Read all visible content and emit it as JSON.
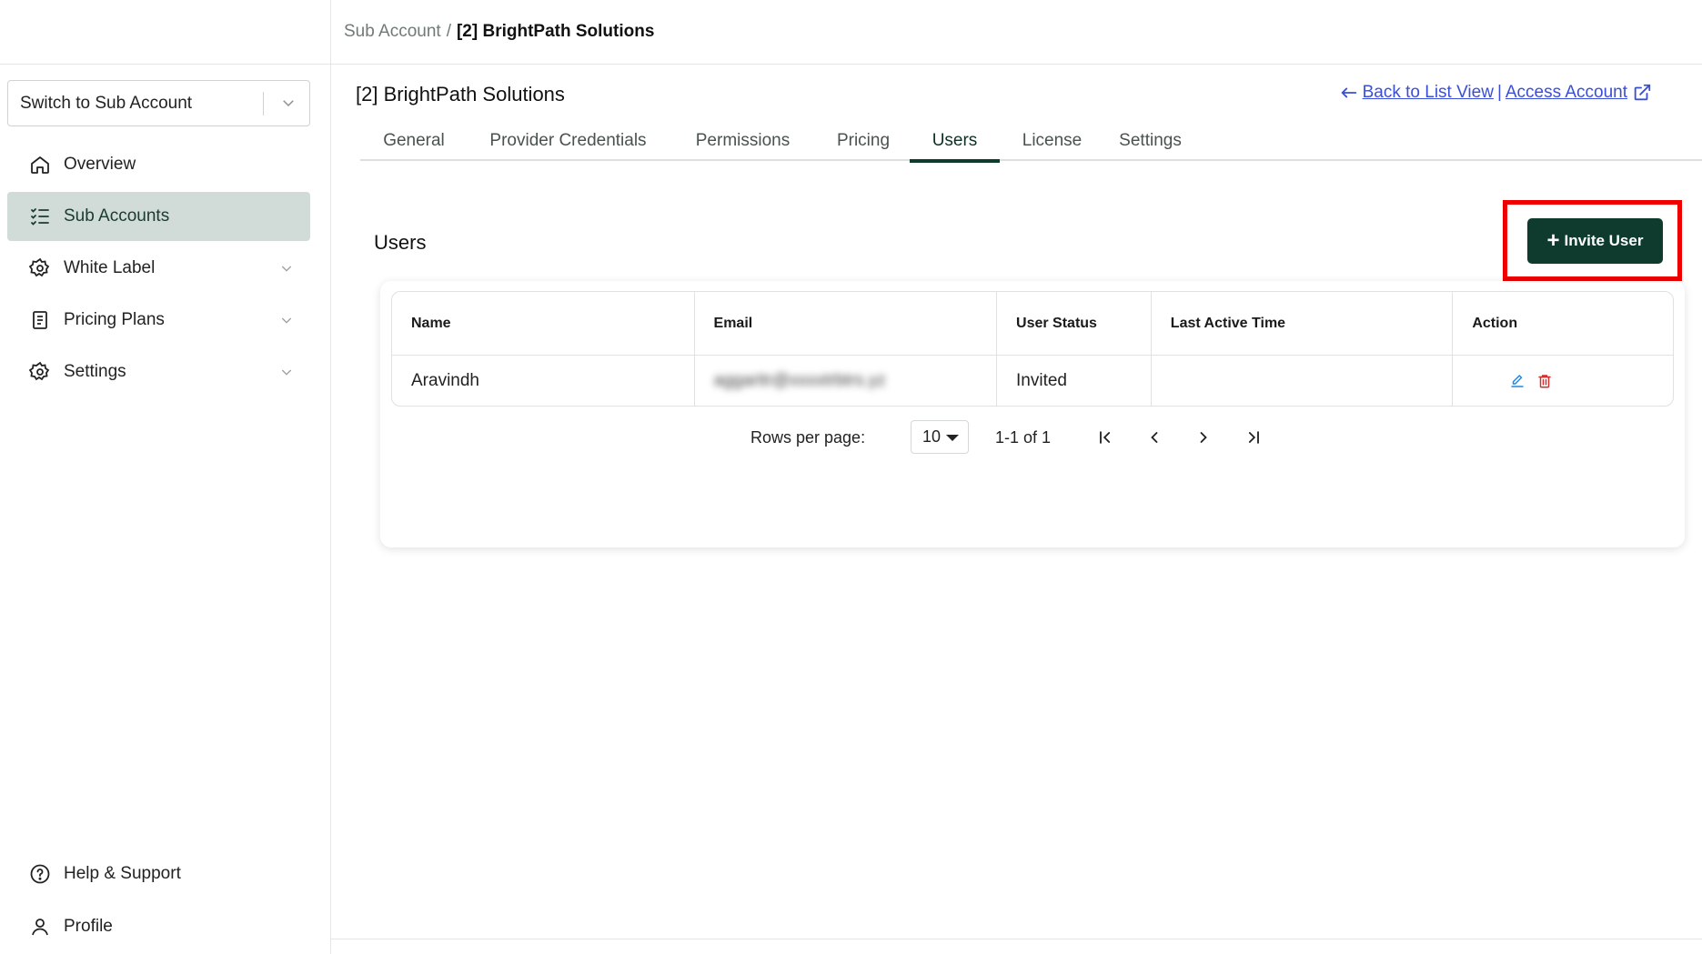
{
  "breadcrumb": {
    "parent": "Sub Account",
    "separator": "/",
    "current": "[2] BrightPath Solutions"
  },
  "sidebar": {
    "switch_placeholder": "Switch to Sub Account",
    "items": [
      {
        "label": "Overview",
        "icon": "home-icon"
      },
      {
        "label": "Sub Accounts",
        "icon": "checklist-icon"
      },
      {
        "label": "White Label",
        "icon": "gear-icon"
      },
      {
        "label": "Pricing Plans",
        "icon": "receipt-icon"
      },
      {
        "label": "Settings",
        "icon": "gear-icon"
      }
    ],
    "bottom_items": [
      {
        "label": "Help & Support",
        "icon": "question-circle-icon"
      },
      {
        "label": "Profile",
        "icon": "person-icon"
      }
    ]
  },
  "page": {
    "title": "[2] BrightPath Solutions",
    "back_link": "Back to List View",
    "divider": "|",
    "access_link": "Access Account"
  },
  "tabs": [
    {
      "label": "General"
    },
    {
      "label": "Provider Credentials"
    },
    {
      "label": "Permissions"
    },
    {
      "label": "Pricing"
    },
    {
      "label": "Users"
    },
    {
      "label": "License"
    },
    {
      "label": "Settings"
    }
  ],
  "users": {
    "section_title": "Users",
    "invite_label": "Invite User",
    "invite_plus": "+",
    "columns": [
      "Name",
      "Email",
      "User Status",
      "Last Active Time",
      "Action"
    ],
    "rows": [
      {
        "name": "Aravindh",
        "email": "aggaritr@xxxxtrbtrs.yz",
        "status": "Invited",
        "last_active": ""
      }
    ]
  },
  "pagination": {
    "rows_per_page_label": "Rows per page:",
    "rows_per_page": "10",
    "range": "1-1 of 1"
  },
  "colors": {
    "primary": "#0e3b2e",
    "active_nav_bg": "#d1dcd8",
    "link": "#3b4fd6",
    "highlight": "#ee0000",
    "edit": "#1e88e5",
    "delete": "#d32f2f"
  }
}
